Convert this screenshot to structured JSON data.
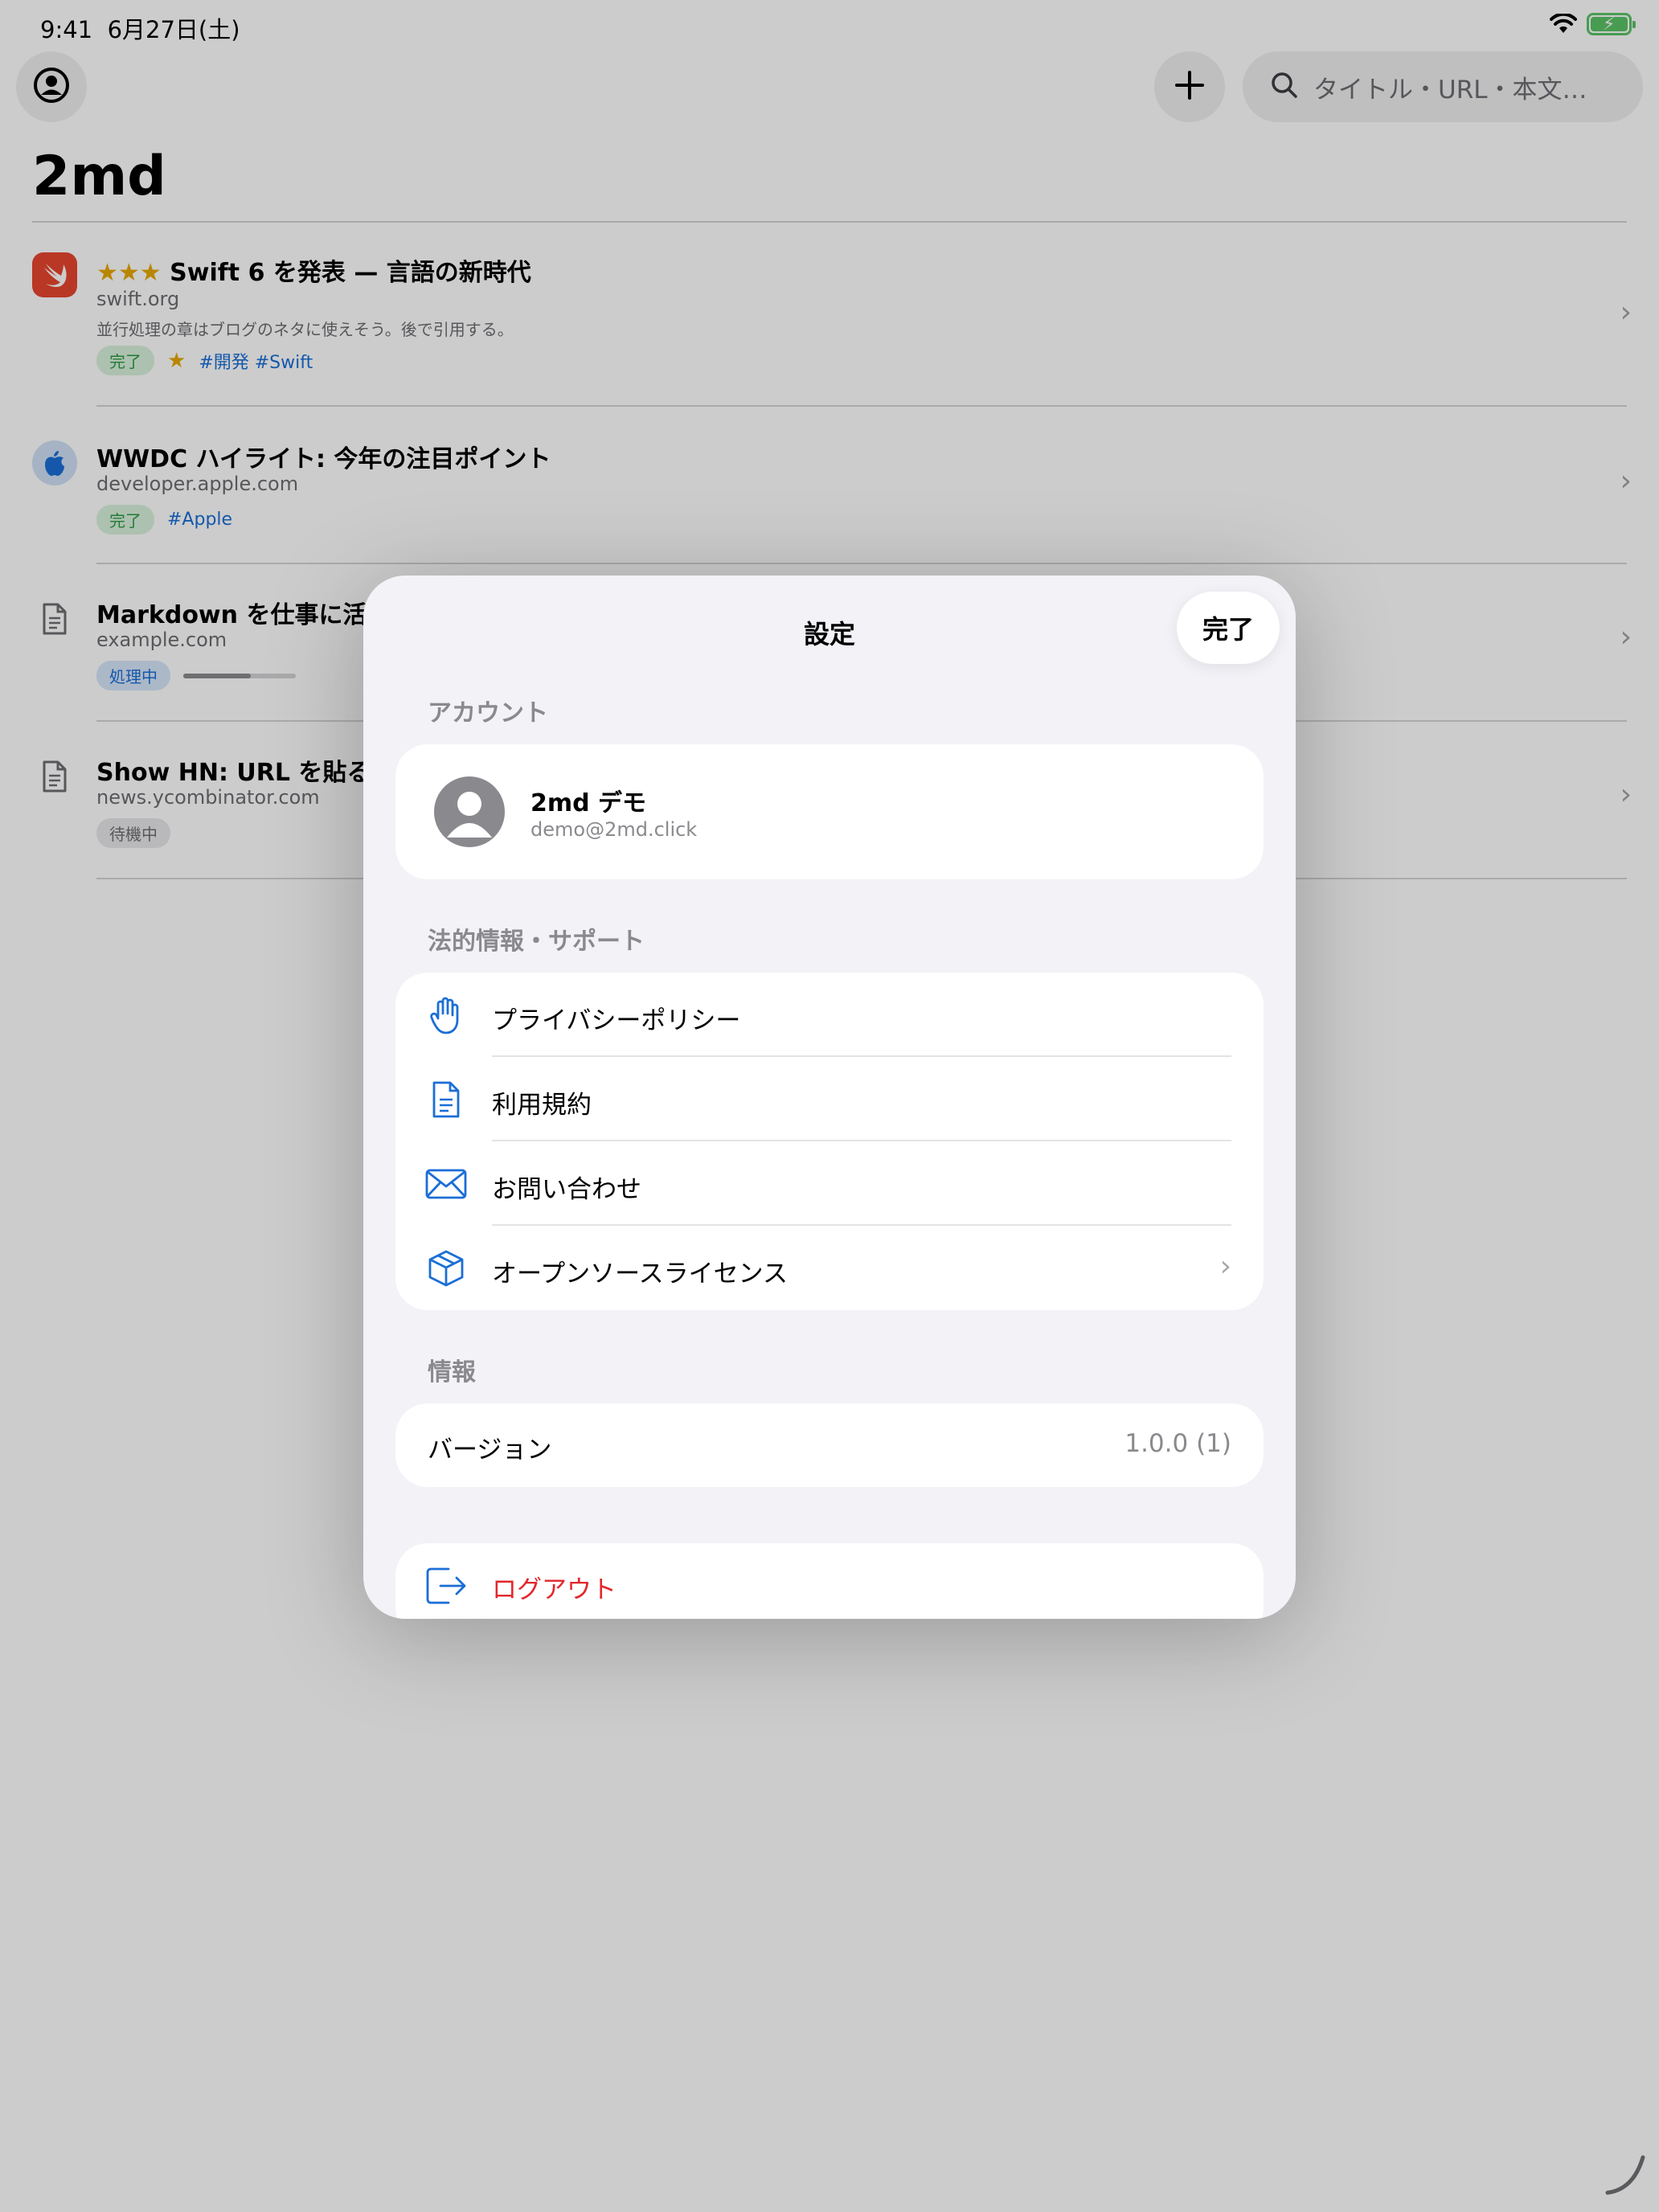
{
  "status_bar": {
    "time": "9:41",
    "date": "6月27日(土)"
  },
  "toolbar": {
    "search_placeholder": "タイトル・URL・本文…"
  },
  "page": {
    "title": "2md"
  },
  "articles": [
    {
      "stars": "★★★",
      "title": "Swift 6 を発表 — 言語の新時代",
      "domain": "swift.org",
      "note": "並行処理の章はブログのネタに使えそう。後で引用する。",
      "status": "完了",
      "favorite": "★",
      "tags": "#開発 #Swift",
      "icon": "swift-icon"
    },
    {
      "title": "WWDC ハイライト: 今年の注目ポイント",
      "domain": "developer.apple.com",
      "status": "完了",
      "tags": "#Apple",
      "icon": "apple-icon"
    },
    {
      "title": "Markdown を仕事に活かす",
      "domain": "example.com",
      "status": "処理中",
      "progress": 0.6,
      "icon": "document-icon"
    },
    {
      "title": "Show HN: URL を貼るだけ",
      "domain": "news.ycombinator.com",
      "status": "待機中",
      "icon": "document-icon"
    }
  ],
  "settings": {
    "title": "設定",
    "done_label": "完了",
    "account_header": "アカウント",
    "account": {
      "name": "2md デモ",
      "email": "demo@2md.click"
    },
    "legal_header": "法的情報・サポート",
    "legal_items": [
      {
        "label": "プライバシーポリシー",
        "icon": "hand-raised-icon"
      },
      {
        "label": "利用規約",
        "icon": "document-icon"
      },
      {
        "label": "お問い合わせ",
        "icon": "envelope-icon"
      },
      {
        "label": "オープンソースライセンス",
        "icon": "shipping-box-icon"
      }
    ],
    "info_header": "情報",
    "version_label": "バージョン",
    "version_value": "1.0.0 (1)",
    "logout_label": "ログアウト"
  },
  "colors": {
    "accent": "#1b6ed6",
    "destructive": "#e3262b",
    "success": "#2b9a43",
    "star": "#e6a800"
  }
}
